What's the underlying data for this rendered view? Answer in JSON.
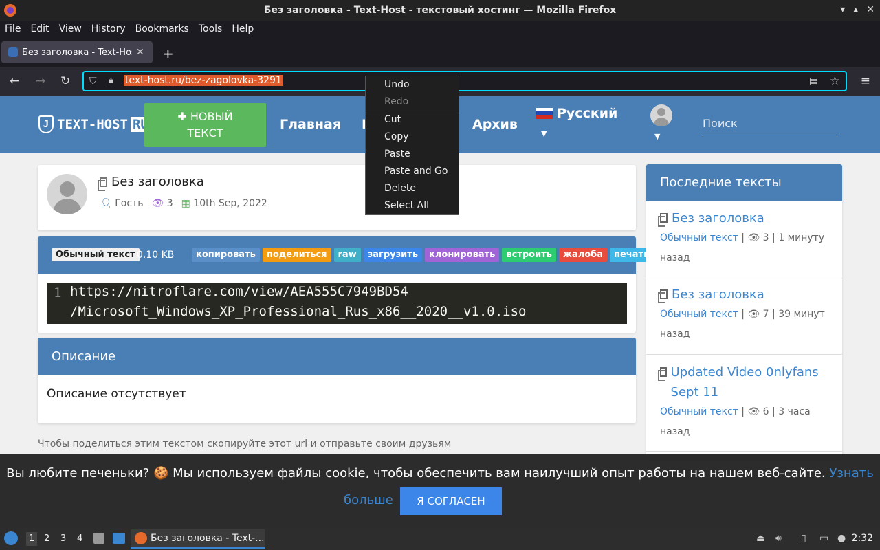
{
  "window": {
    "title": "Без заголовка - Text-Host - текстовый хостинг — Mozilla Firefox",
    "controls": [
      "▾",
      "▴",
      "✕"
    ]
  },
  "menubar": [
    "File",
    "Edit",
    "View",
    "History",
    "Bookmarks",
    "Tools",
    "Help"
  ],
  "tab": {
    "title": "Без заголовка - Text-Host",
    "close": "✕",
    "new": "+"
  },
  "nav": {
    "url": "text-host.ru/bez-zagolovka-3291"
  },
  "site": {
    "logo": "TEXT-HOST",
    "logo_ru": "RU",
    "new_button_line1": "✚ НОВЫЙ",
    "new_button_line2": "ТЕКСТ",
    "nav_home": "Главная",
    "nav_partial": "П",
    "nav_archive": "Архив",
    "language": "Русский",
    "search_placeholder": "Поиск"
  },
  "post": {
    "title": "Без заголовка",
    "author": "Гость",
    "views": "3",
    "date": "10th Sep, 2022"
  },
  "code": {
    "type_badge": "Обычный текст",
    "size": "0.10 KB",
    "buttons": [
      {
        "label": "копировать",
        "color": "#5a8fc7"
      },
      {
        "label": "поделиться",
        "color": "#f39c12"
      },
      {
        "label": "raw",
        "color": "#3fb0c8"
      },
      {
        "label": "загрузить",
        "color": "#3b86e8"
      },
      {
        "label": "клонировать",
        "color": "#a064d6"
      },
      {
        "label": "встроить",
        "color": "#2ecc71"
      },
      {
        "label": "жалоба",
        "color": "#e74c3c"
      },
      {
        "label": "печать",
        "color": "#3db8e8"
      }
    ],
    "line_number": "1",
    "line1": "https://nitroflare.com/view/AEA555C7949BD54",
    "line2": "/Microsoft_Windows_XP_Professional_Rus_x86__2020__v1.0.iso"
  },
  "description": {
    "header": "Описание",
    "text": "Описание отсутствует"
  },
  "share_text": "Чтобы поделиться этим текстом скопируйте этот url и отправьте своим друзьям",
  "sidebar": {
    "header": "Последние тексты",
    "items": [
      {
        "title": "Без заголовка",
        "type": "Обычный текст",
        "views": "3",
        "time": "1 минуту назад"
      },
      {
        "title": "Без заголовка",
        "type": "Обычный текст",
        "views": "7",
        "time": "39 минут назад"
      },
      {
        "title": "Updated Video 0nlyfans Sept 11",
        "type": "Обычный текст",
        "views": "6",
        "time": "3 часа назад"
      }
    ]
  },
  "cookie": {
    "text": "Вы любите печеньки? 🍪 Мы используем файлы cookie, чтобы обеспечить вам наилучший опыт работы на нашем веб-сайте.",
    "link1": "Узнать",
    "link2": "больше",
    "agree": "Я СОГЛАСЕН"
  },
  "context_menu": {
    "undo": "Undo",
    "redo": "Redo",
    "cut": "Cut",
    "copy": "Copy",
    "paste": "Paste",
    "paste_go": "Paste and Go",
    "delete": "Delete",
    "select_all": "Select All"
  },
  "taskbar": {
    "workspaces": [
      "1",
      "2",
      "3",
      "4"
    ],
    "task_title": "Без заголовка - Text-...",
    "clock": "2:32"
  },
  "colors": {
    "accent": "#4a7fb5",
    "green": "#5cb85c",
    "link": "#3b86d0"
  }
}
